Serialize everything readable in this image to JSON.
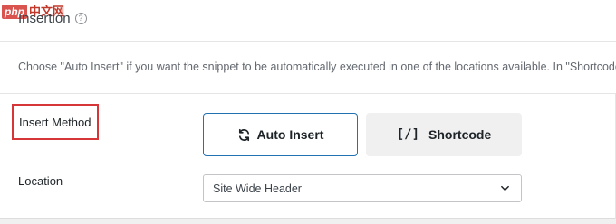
{
  "watermark": {
    "badge": "php",
    "text": "中文网"
  },
  "section": {
    "title": "Insertion"
  },
  "description": "Choose \"Auto Insert\" if you want the snippet to be automatically executed in one of the locations available. In \"Shortcode\" mode,",
  "insert_method": {
    "label": "Insert Method",
    "options": [
      {
        "label": "Auto Insert",
        "icon": "sync-icon",
        "selected": true
      },
      {
        "label": "Shortcode",
        "icon": "shortcode-icon",
        "icon_text": "[/]",
        "selected": false
      }
    ]
  },
  "location": {
    "label": "Location",
    "selected": "Site Wide Header"
  },
  "colors": {
    "selected_border": "#2271b1",
    "highlight_box": "#d63638",
    "unselected_bg": "#f0f0f1"
  }
}
